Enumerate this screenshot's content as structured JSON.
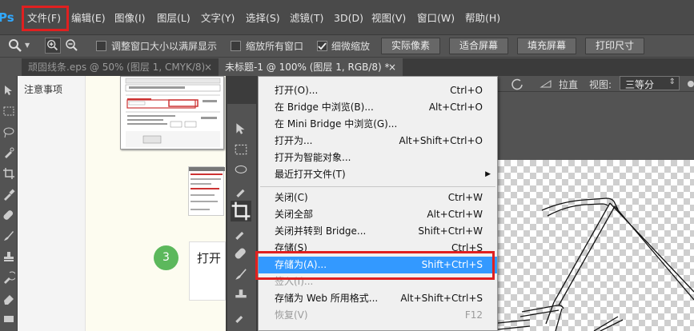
{
  "app": {
    "logo": "Ps",
    "accent_color": "#31a8ff",
    "highlight_color": "#e02020"
  },
  "menubar": {
    "items": [
      "文件(F)",
      "编辑(E)",
      "图像(I)",
      "图层(L)",
      "文字(Y)",
      "选择(S)",
      "滤镜(T)",
      "3D(D)",
      "视图(V)",
      "窗口(W)",
      "帮助(H)"
    ]
  },
  "options": {
    "resize_windows_label": "调整窗口大小以满屏显示",
    "zoom_all_label": "缩放所有窗口",
    "scrubby_zoom_label": "细微缩放",
    "actual_pixels": "实际像素",
    "fit_screen": "适合屏幕",
    "fill_screen": "填充屏幕",
    "print_size": "打印尺寸"
  },
  "tabs": [
    {
      "label": "顽固线条.eps @ 50% (图层 1, CMYK/8)",
      "close": "×"
    },
    {
      "label": "未标题-1 @ 100% (图层 1, RGB/8) *",
      "close": "×"
    }
  ],
  "notes_panel": {
    "title": "注意事项"
  },
  "step": {
    "number": "3",
    "text": "打开"
  },
  "right_bar": {
    "straighten": "拉直",
    "view_label": "视图:",
    "view_value": "三等分"
  },
  "file_menu": {
    "items": [
      {
        "label": "打开(O)...",
        "shortcut": "Ctrl+O",
        "state": "normal"
      },
      {
        "label": "在 Bridge 中浏览(B)...",
        "shortcut": "Alt+Ctrl+O",
        "state": "normal"
      },
      {
        "label": "在 Mini Bridge 中浏览(G)...",
        "shortcut": "",
        "state": "normal"
      },
      {
        "label": "打开为...",
        "shortcut": "Alt+Shift+Ctrl+O",
        "state": "normal"
      },
      {
        "label": "打开为智能对象...",
        "shortcut": "",
        "state": "normal"
      },
      {
        "label": "最近打开文件(T)",
        "shortcut": "",
        "state": "submenu"
      },
      {
        "label": "关闭(C)",
        "shortcut": "Ctrl+W",
        "state": "normal"
      },
      {
        "label": "关闭全部",
        "shortcut": "Alt+Ctrl+W",
        "state": "normal"
      },
      {
        "label": "关闭并转到 Bridge...",
        "shortcut": "Shift+Ctrl+W",
        "state": "normal"
      },
      {
        "label": "存储(S)",
        "shortcut": "Ctrl+S",
        "state": "normal"
      },
      {
        "label": "存储为(A)...",
        "shortcut": "Shift+Ctrl+S",
        "state": "highlight"
      },
      {
        "label": "签入(I)...",
        "shortcut": "",
        "state": "disabled"
      },
      {
        "label": "存储为 Web 所用格式...",
        "shortcut": "Alt+Shift+Ctrl+S",
        "state": "normal"
      },
      {
        "label": "恢复(V)",
        "shortcut": "F12",
        "state": "disabled"
      }
    ]
  }
}
